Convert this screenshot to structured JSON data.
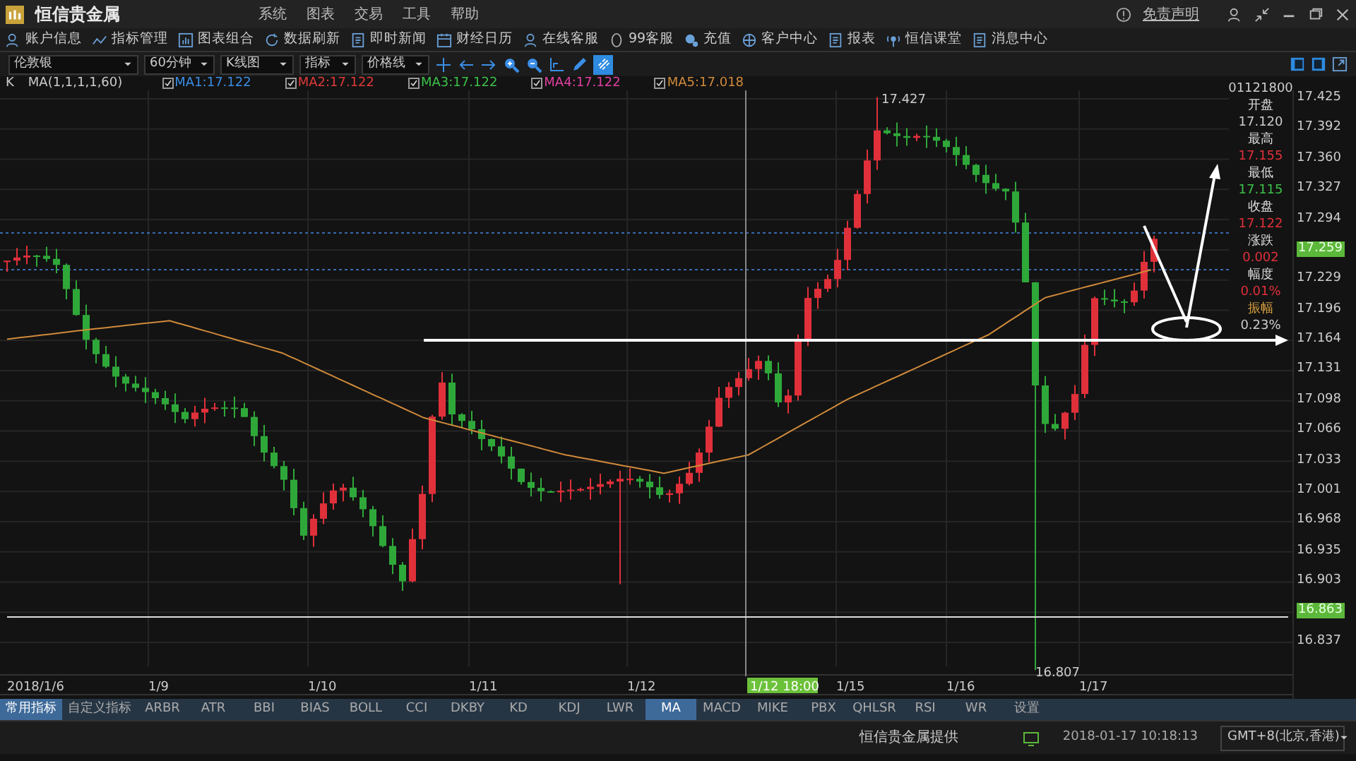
{
  "app": {
    "title": "恒信贵金属",
    "menu": [
      "系统",
      "图表",
      "交易",
      "工具",
      "帮助"
    ],
    "disclaimer": "免责声明"
  },
  "toolbar": [
    "账户信息",
    "指标管理",
    "图表组合",
    "数据刷新",
    "即时新闻",
    "财经日历",
    "在线客服",
    "99客服",
    "充值",
    "客户中心",
    "报表",
    "恒信课堂",
    "消息中心"
  ],
  "controls": {
    "dropdowns": [
      "伦敦银",
      "60分钟",
      "K线图",
      "指标",
      "价格线"
    ]
  },
  "legend": {
    "type": "K",
    "params": "MA(1,1,1,1,60)",
    "items": [
      {
        "label": "MA1:17.122",
        "color": "#3a8ee6",
        "checked": true
      },
      {
        "label": "MA2:17.122",
        "color": "#e03a3a",
        "checked": true
      },
      {
        "label": "MA3:17.122",
        "color": "#3cc04a",
        "checked": true
      },
      {
        "label": "MA4:17.122",
        "color": "#e040a0",
        "checked": true
      },
      {
        "label": "MA5:17.018",
        "color": "#d08a3a",
        "checked": true
      }
    ]
  },
  "chart": {
    "high_label": "17.427",
    "low_label": "16.807",
    "crosshair_label": "1/12 18:00",
    "x_labels": [
      "2018/1/6",
      "1/9",
      "1/10",
      "1/11",
      "1/12",
      "1/15",
      "1/16",
      "1/17"
    ],
    "y_axis": [
      {
        "text": "17.425",
        "kind": "tick"
      },
      {
        "text": "17.392",
        "kind": "tick"
      },
      {
        "text": "17.360",
        "kind": "tick"
      },
      {
        "text": "17.327",
        "kind": "tick"
      },
      {
        "text": "17.294",
        "kind": "tick"
      },
      {
        "text": "17.259",
        "kind": "tag"
      },
      {
        "text": "17.229",
        "kind": "tick"
      },
      {
        "text": "17.196",
        "kind": "tick"
      },
      {
        "text": "17.164",
        "kind": "tick"
      },
      {
        "text": "17.131",
        "kind": "tick"
      },
      {
        "text": "17.098",
        "kind": "tick"
      },
      {
        "text": "17.066",
        "kind": "tick"
      },
      {
        "text": "17.033",
        "kind": "tick"
      },
      {
        "text": "17.001",
        "kind": "tick"
      },
      {
        "text": "16.968",
        "kind": "tick"
      },
      {
        "text": "16.935",
        "kind": "tick"
      },
      {
        "text": "16.903",
        "kind": "tick"
      },
      {
        "text": "16.863",
        "kind": "tag"
      },
      {
        "text": "16.837",
        "kind": "tick"
      }
    ],
    "info": {
      "time": "01121800",
      "fields": [
        {
          "label": "开盘",
          "value": "17.120",
          "kind": "neutral"
        },
        {
          "label": "最高",
          "value": "17.155",
          "kind": "up"
        },
        {
          "label": "最低",
          "value": "17.115",
          "kind": "down"
        },
        {
          "label": "收盘",
          "value": "17.122",
          "kind": "up"
        },
        {
          "label": "涨跌",
          "value": "0.002",
          "kind": "up"
        },
        {
          "label": "幅度",
          "value": "0.01%",
          "kind": "up"
        },
        {
          "label": "振幅",
          "value": "0.23%",
          "kind": "highlight"
        }
      ]
    }
  },
  "indicator_tabs": {
    "groups": [
      {
        "label": "常用指标",
        "selected": true
      },
      {
        "label": "自定义指标",
        "selected": false
      }
    ],
    "items": [
      {
        "label": "ARBR",
        "selected": false
      },
      {
        "label": "ATR",
        "selected": false
      },
      {
        "label": "BBI",
        "selected": false
      },
      {
        "label": "BIAS",
        "selected": false
      },
      {
        "label": "BOLL",
        "selected": false
      },
      {
        "label": "CCI",
        "selected": false
      },
      {
        "label": "DKBY",
        "selected": false
      },
      {
        "label": "KD",
        "selected": false
      },
      {
        "label": "KDJ",
        "selected": false
      },
      {
        "label": "LWR",
        "selected": false
      },
      {
        "label": "MA",
        "selected": true
      },
      {
        "label": "MACD",
        "selected": false
      },
      {
        "label": "MIKE",
        "selected": false
      },
      {
        "label": "PBX",
        "selected": false
      },
      {
        "label": "QHLSR",
        "selected": false
      },
      {
        "label": "RSI",
        "selected": false
      },
      {
        "label": "WR",
        "selected": false
      }
    ],
    "settings": "设置"
  },
  "status_bar": {
    "provider": "恒信贵金属提供",
    "datetime": "2018-01-17 10:18:13",
    "timezone": "GMT+8(北京,香港)"
  }
}
